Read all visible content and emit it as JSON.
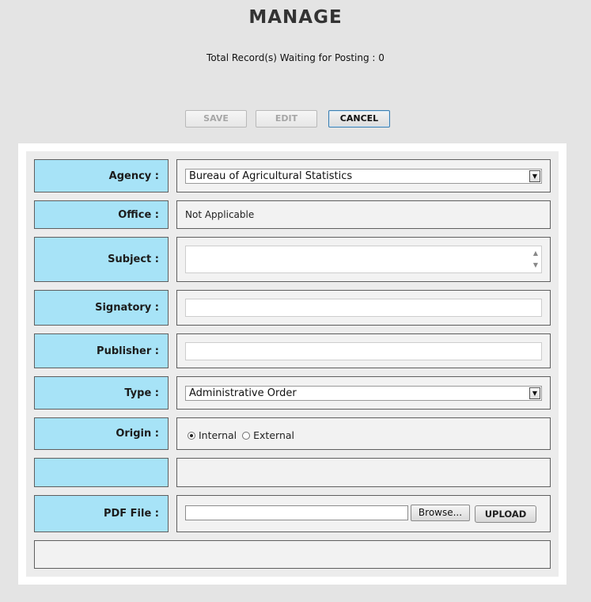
{
  "page": {
    "title": "MANAGE",
    "waiting_text": "Total Record(s) Waiting for Posting : 0"
  },
  "toolbar": {
    "save_label": "SAVE",
    "edit_label": "EDIT",
    "cancel_label": "CANCEL"
  },
  "form": {
    "agency": {
      "label": "Agency :",
      "value": "Bureau of Agricultural Statistics"
    },
    "office": {
      "label": "Office :",
      "value": "Not Applicable"
    },
    "subject": {
      "label": "Subject :",
      "value": ""
    },
    "signatory": {
      "label": "Signatory :",
      "value": ""
    },
    "publisher": {
      "label": "Publisher :",
      "value": ""
    },
    "type": {
      "label": "Type :",
      "value": "Administrative Order"
    },
    "origin": {
      "label": "Origin :",
      "options": [
        "Internal",
        "External"
      ],
      "selected": "Internal"
    },
    "pdf": {
      "label": "PDF File :",
      "browse_label": "Browse...",
      "upload_label": "UPLOAD"
    }
  },
  "colors": {
    "label_bg": "#a7e3f7",
    "value_bg": "#f2f2f2",
    "page_bg": "#e4e4e4",
    "cancel_border": "#3c7fb1"
  }
}
